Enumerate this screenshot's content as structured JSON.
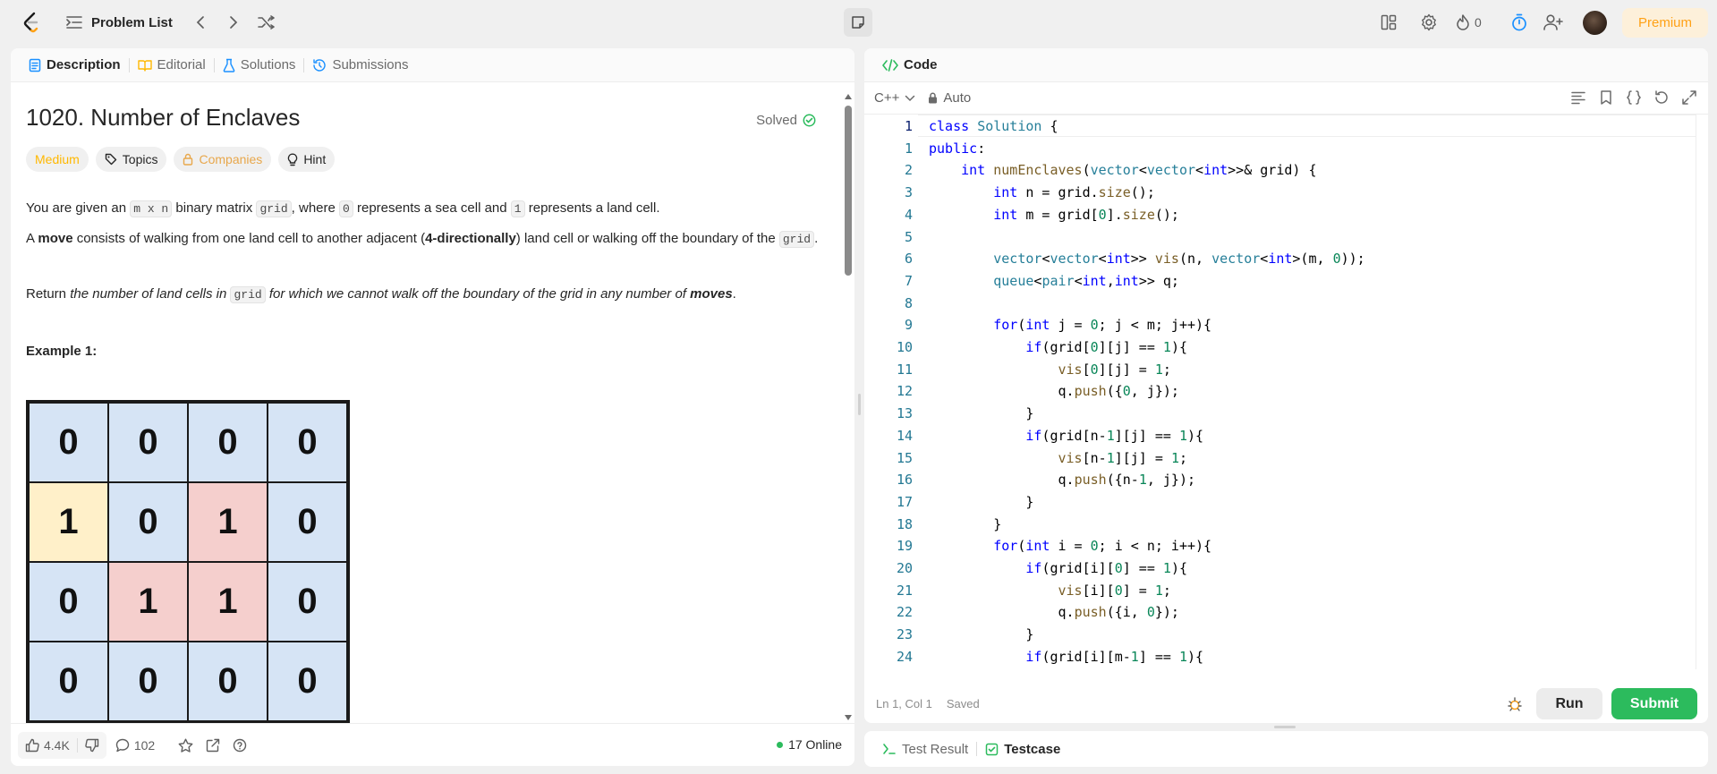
{
  "topbar": {
    "logo_icon": "leetcode-logo-icon",
    "problem_list_label": "Problem List",
    "streak_count": "0",
    "premium_label": "Premium"
  },
  "left_panel": {
    "tabs": [
      {
        "label": "Description",
        "icon": "document-icon",
        "active": true
      },
      {
        "label": "Editorial",
        "icon": "book-icon",
        "active": false
      },
      {
        "label": "Solutions",
        "icon": "flask-icon",
        "active": false
      },
      {
        "label": "Submissions",
        "icon": "history-icon",
        "active": false
      }
    ],
    "title": "1020. Number of Enclaves",
    "solved_label": "Solved",
    "chips": {
      "difficulty": "Medium",
      "topics": "Topics",
      "companies": "Companies",
      "hint": "Hint"
    },
    "para1": {
      "t1": "You are given an ",
      "c1": "m x n",
      "t2": " binary matrix ",
      "c2": "grid",
      "t3": ", where ",
      "c3": "0",
      "t4": " represents a sea cell and ",
      "c4": "1",
      "t5": " represents a land cell."
    },
    "para2": {
      "t1": "A ",
      "b1": "move",
      "t2": " consists of walking from one land cell to another adjacent (",
      "b2": "4-directionally",
      "t3": ") land cell or walking off the boundary of the ",
      "c1": "grid",
      "t4": "."
    },
    "para3": {
      "t1": "Return ",
      "i1": "the number of land cells in ",
      "c1": "grid",
      "i2": " for which we cannot walk off the boundary of the grid in any number of ",
      "b1": "moves",
      "t2": "."
    },
    "example_label": "Example 1:",
    "example_grid": [
      [
        {
          "v": "0",
          "c": "blue"
        },
        {
          "v": "0",
          "c": "blue"
        },
        {
          "v": "0",
          "c": "blue"
        },
        {
          "v": "0",
          "c": "blue"
        }
      ],
      [
        {
          "v": "1",
          "c": "yellow"
        },
        {
          "v": "0",
          "c": "blue"
        },
        {
          "v": "1",
          "c": "red"
        },
        {
          "v": "0",
          "c": "blue"
        }
      ],
      [
        {
          "v": "0",
          "c": "blue"
        },
        {
          "v": "1",
          "c": "red"
        },
        {
          "v": "1",
          "c": "red"
        },
        {
          "v": "0",
          "c": "blue"
        }
      ],
      [
        {
          "v": "0",
          "c": "blue"
        },
        {
          "v": "0",
          "c": "blue"
        },
        {
          "v": "0",
          "c": "blue"
        },
        {
          "v": "0",
          "c": "blue"
        }
      ]
    ],
    "footer": {
      "likes": "4.4K",
      "comments": "102",
      "online": "17 Online"
    }
  },
  "editor": {
    "tab_label": "Code",
    "language": "C++",
    "mode": "Auto",
    "cursor_position": "Ln 1, Col 1",
    "save_status": "Saved",
    "run_label": "Run",
    "submit_label": "Submit",
    "lines": [
      {
        "n": "1",
        "code": "class Solution {"
      },
      {
        "n": "1",
        "code": "public:"
      },
      {
        "n": "2",
        "code": "    int numEnclaves(vector<vector<int>>& grid) {"
      },
      {
        "n": "3",
        "code": "        int n = grid.size();"
      },
      {
        "n": "4",
        "code": "        int m = grid[0].size();"
      },
      {
        "n": "5",
        "code": ""
      },
      {
        "n": "6",
        "code": "        vector<vector<int>> vis(n, vector<int>(m, 0));"
      },
      {
        "n": "7",
        "code": "        queue<pair<int,int>> q;"
      },
      {
        "n": "8",
        "code": ""
      },
      {
        "n": "9",
        "code": "        for(int j = 0; j < m; j++){"
      },
      {
        "n": "10",
        "code": "            if(grid[0][j] == 1){"
      },
      {
        "n": "11",
        "code": "                vis[0][j] = 1;"
      },
      {
        "n": "12",
        "code": "                q.push({0, j});"
      },
      {
        "n": "13",
        "code": "            }"
      },
      {
        "n": "14",
        "code": "            if(grid[n-1][j] == 1){"
      },
      {
        "n": "15",
        "code": "                vis[n-1][j] = 1;"
      },
      {
        "n": "16",
        "code": "                q.push({n-1, j});"
      },
      {
        "n": "17",
        "code": "            }"
      },
      {
        "n": "18",
        "code": "        }"
      },
      {
        "n": "19",
        "code": "        for(int i = 0; i < n; i++){"
      },
      {
        "n": "20",
        "code": "            if(grid[i][0] == 1){"
      },
      {
        "n": "21",
        "code": "                vis[i][0] = 1;"
      },
      {
        "n": "22",
        "code": "                q.push({i, 0});"
      },
      {
        "n": "23",
        "code": "            }"
      },
      {
        "n": "24",
        "code": "            if(grid[i][m-1] == 1){"
      }
    ]
  },
  "test_panel": {
    "test_result_label": "Test Result",
    "testcase_label": "Testcase"
  },
  "colors": {
    "accent_orange": "#ffa116",
    "submit_green": "#2cbb5d",
    "timer_blue": "#1a90ff",
    "cell_blue": "#d6e4f5",
    "cell_yellow": "#fff0c9",
    "cell_red": "#f5cfcd"
  }
}
